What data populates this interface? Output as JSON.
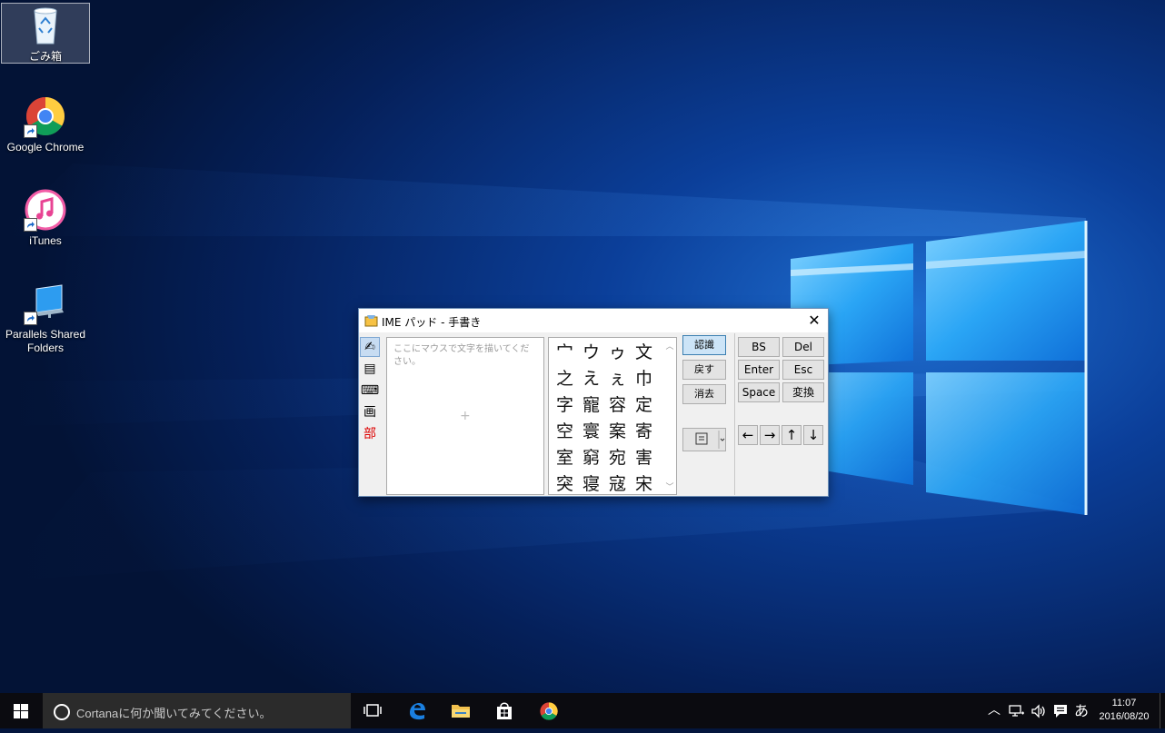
{
  "desktop": {
    "icons": [
      {
        "label": "ごみ箱",
        "icon": "recycle-bin-icon"
      },
      {
        "label": "Google Chrome",
        "icon": "chrome-icon"
      },
      {
        "label": "iTunes",
        "icon": "itunes-icon"
      },
      {
        "label": "Parallels Shared Folders",
        "icon": "shared-folders-icon"
      }
    ]
  },
  "ime_pad": {
    "title": "IME パッド - 手書き",
    "tools": [
      "✍",
      "▤",
      "⌨",
      "画",
      "部"
    ],
    "placeholder": "ここにマウスで文字を描いてください。",
    "candidates": [
      "宀",
      "ウ",
      "ゥ",
      "文",
      "之",
      "え",
      "ぇ",
      "巾",
      "字",
      "寵",
      "容",
      "定",
      "空",
      "寰",
      "案",
      "寄",
      "室",
      "窮",
      "宛",
      "害",
      "突",
      "寝",
      "寇",
      "宋"
    ],
    "actions": {
      "recognize": "認識",
      "undo": "戻す",
      "clear": "消去"
    },
    "keys": {
      "bs": "BS",
      "del": "Del",
      "enter": "Enter",
      "esc": "Esc",
      "space": "Space",
      "convert": "変換"
    },
    "arrows": [
      "←",
      "→",
      "↑",
      "↓"
    ]
  },
  "taskbar": {
    "search_placeholder": "Cortanaに何か聞いてみてください。",
    "ime_mode": "あ",
    "time": "11:07",
    "date": "2016/08/20"
  }
}
